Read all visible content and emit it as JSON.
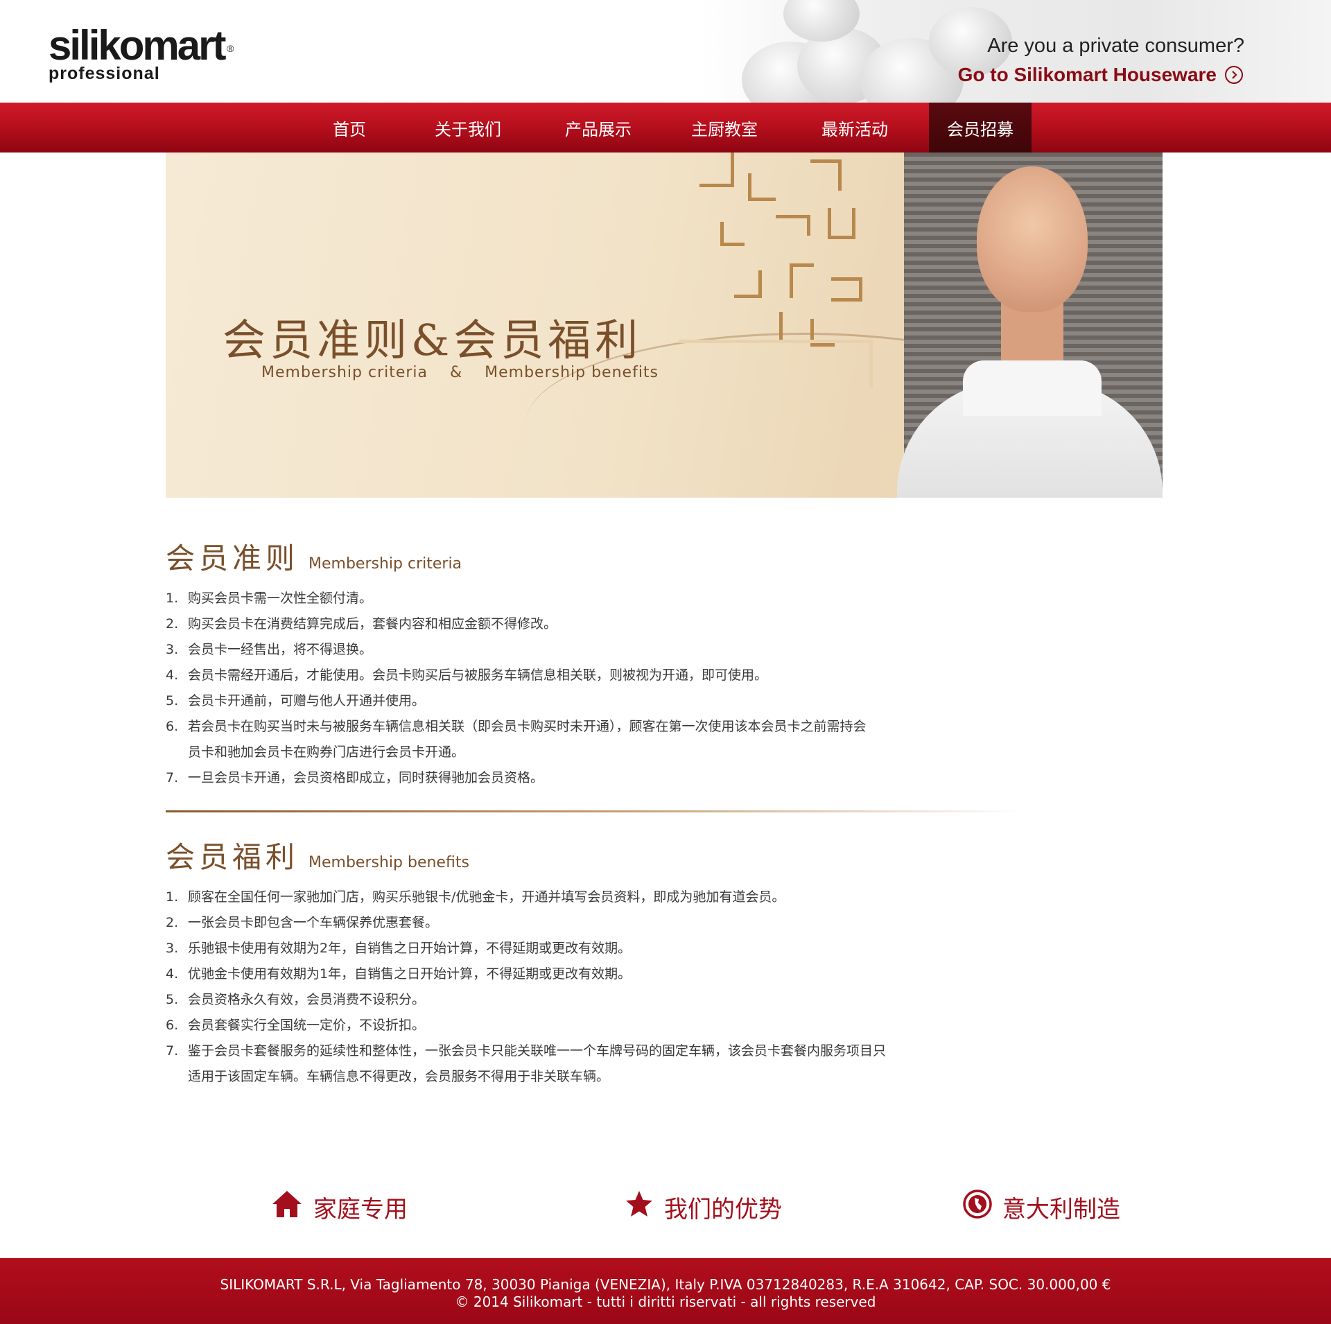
{
  "header": {
    "logo_main": "silikomart",
    "logo_reg": "®",
    "logo_sub": "professional",
    "consumer_question": "Are you a private consumer?",
    "houseware_link": "Go to Silikomart Houseware"
  },
  "nav": {
    "items": [
      {
        "label": "首页"
      },
      {
        "label": "关于我们"
      },
      {
        "label": "产品展示"
      },
      {
        "label": "主厨教室"
      },
      {
        "label": "最新活动"
      },
      {
        "label": "会员招募",
        "active": true
      }
    ]
  },
  "banner": {
    "title": "会员准则&会员福利",
    "subtitle": "Membership criteria    &    Membership benefits"
  },
  "criteria": {
    "title_zh": "会员准则",
    "title_en": "Membership criteria",
    "items": [
      {
        "num": "1.",
        "text": "购买会员卡需一次性全额付清。"
      },
      {
        "num": "2.",
        "text": "购买会员卡在消费结算完成后，套餐内容和相应金额不得修改。"
      },
      {
        "num": "3.",
        "text": "会员卡一经售出，将不得退换。"
      },
      {
        "num": "4.",
        "text": "会员卡需经开通后，才能使用。会员卡购买后与被服务车辆信息相关联，则被视为开通，即可使用。"
      },
      {
        "num": "5.",
        "text": "会员卡开通前，可赠与他人开通并使用。"
      },
      {
        "num": "6.",
        "text": "若会员卡在购买当时未与被服务车辆信息相关联（即会员卡购买时未开通），顾客在第一次使用该本会员卡之前需持会员卡和驰加会员卡在购券门店进行会员卡开通。"
      },
      {
        "num": "7.",
        "text": "一旦会员卡开通，会员资格即成立，同时获得驰加会员资格。"
      }
    ]
  },
  "benefits": {
    "title_zh": "会员福利",
    "title_en": "Membership benefits",
    "items": [
      {
        "num": "1.",
        "text": "顾客在全国任何一家驰加门店，购买乐驰银卡/优驰金卡，开通并填写会员资料，即成为驰加有道会员。"
      },
      {
        "num": "2.",
        "text": "一张会员卡即包含一个车辆保养优惠套餐。"
      },
      {
        "num": "3.",
        "text": "乐驰银卡使用有效期为2年，自销售之日开始计算，不得延期或更改有效期。"
      },
      {
        "num": "4.",
        "text": "优驰金卡使用有效期为1年，自销售之日开始计算，不得延期或更改有效期。"
      },
      {
        "num": "5.",
        "text": "会员资格永久有效，会员消费不设积分。"
      },
      {
        "num": "6.",
        "text": "会员套餐实行全国统一定价，不设折扣。"
      },
      {
        "num": "7.",
        "text": "鉴于会员卡套餐服务的延续性和整体性，一张会员卡只能关联唯一一个车牌号码的固定车辆，该会员卡套餐内服务项目只适用于该固定车辆。车辆信息不得更改，会员服务不得用于非关联车辆。"
      }
    ]
  },
  "features": {
    "home": "家庭专用",
    "advantage": "我们的优势",
    "italy": "意大利制造"
  },
  "footer": {
    "line1": "SILIKOMART S.R.L, Via Tagliamento 78, 30030 Pianiga (VENEZIA), Italy P.IVA 03712840283, R.E.A 310642, CAP. SOC. 30.000,00 €",
    "line2": "© 2014 Silikomart - tutti i diritti riservati - all rights reserved"
  },
  "colors": {
    "brand_red": "#b50e1c",
    "brown_text": "#7a4f2a",
    "nav_active": "#4a070c"
  }
}
